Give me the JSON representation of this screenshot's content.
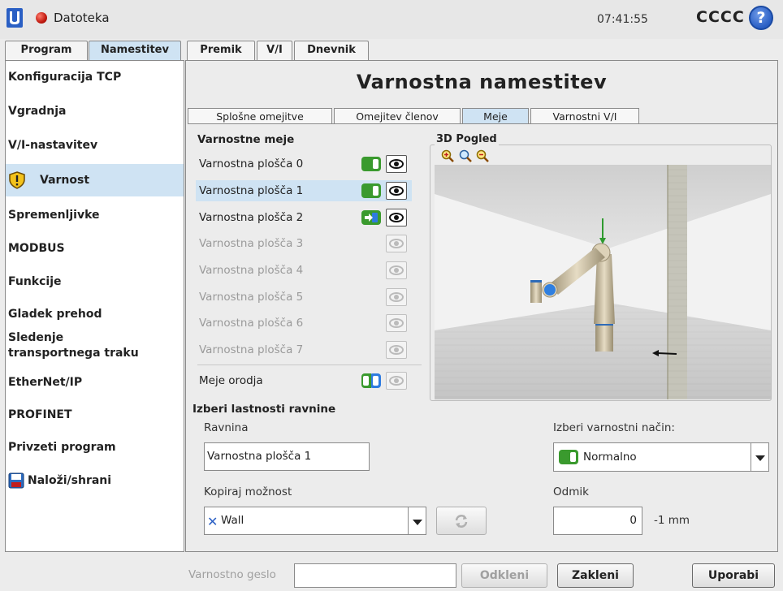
{
  "topbar": {
    "file_label": "Datoteka",
    "clock": "07:41:55",
    "robot_name": "CCCC",
    "help_symbol": "?",
    "icons": [
      "ur-logo-icon",
      "record-dot-icon",
      "help-icon"
    ]
  },
  "main_tabs": [
    "Program",
    "Namestitev",
    "Premik",
    "V/I",
    "Dnevnik"
  ],
  "main_tab_active": "Namestitev",
  "sidebar": {
    "items": [
      {
        "label": "Konfiguracija TCP"
      },
      {
        "label": "Vgradnja"
      },
      {
        "label": "V/I-nastavitev"
      },
      {
        "label": "Varnost",
        "icon": "shield-warning-icon"
      },
      {
        "label": "Spremenljivke"
      },
      {
        "label": "MODBUS"
      },
      {
        "label": "Funkcije"
      },
      {
        "label": "Gladek prehod"
      },
      {
        "label": "Sledenje\ntransportnega traku"
      },
      {
        "label": "EtherNet/IP"
      },
      {
        "label": "PROFINET"
      },
      {
        "label": "Privzeti program"
      },
      {
        "label": "Naloži/shrani",
        "icon": "floppy-disk-icon"
      }
    ],
    "active": "Varnost"
  },
  "content": {
    "title": "Varnostna namestitev",
    "sub_tabs": [
      "Splošne omejitve",
      "Omejitev členov",
      "Meje",
      "Varnostni V/I"
    ],
    "sub_tab_active": "Meje",
    "boundaries": {
      "heading": "Varnostne meje",
      "planes": [
        {
          "label": "Varnostna plošča 0",
          "mode": "normal",
          "enabled": true
        },
        {
          "label": "Varnostna plošča 1",
          "mode": "normal",
          "enabled": true,
          "selected": true
        },
        {
          "label": "Varnostna plošča 2",
          "mode": "trigger",
          "enabled": true
        },
        {
          "label": "Varnostna plošča 3",
          "enabled": false
        },
        {
          "label": "Varnostna plošča 4",
          "enabled": false
        },
        {
          "label": "Varnostna plošča 5",
          "enabled": false
        },
        {
          "label": "Varnostna plošča 6",
          "enabled": false
        },
        {
          "label": "Varnostna plošča 7",
          "enabled": false
        }
      ],
      "tool_boundary": {
        "label": "Meje orodja",
        "mode": "blue"
      }
    },
    "view3d": {
      "title": "3D Pogled",
      "zoom_icons": [
        "zoom-in-icon",
        "zoom-fit-icon",
        "zoom-out-icon"
      ]
    },
    "plane_properties": {
      "heading": "Izberi lastnosti ravnine",
      "plane_label": "Ravnina",
      "plane_value": "Varnostna plošča 1",
      "copy_label": "Kopiraj možnost",
      "copy_value": "Wall",
      "copy_icon": "wall-x-icon",
      "refresh_icon": "refresh-icon",
      "mode_label": "Izberi varnostni način:",
      "mode_value": "Normalno",
      "offset_label": "Odmik",
      "offset_value": "0",
      "offset_unit": "-1 mm"
    }
  },
  "footer": {
    "password_placeholder": "Varnostno geslo",
    "unlock_label": "Odkleni",
    "lock_label": "Zakleni",
    "apply_label": "Uporabi"
  },
  "colors": {
    "accent_selected": "#cfe3f3",
    "toggle_green": "#3a9a2e",
    "toggle_blue": "#2e7be0",
    "record_red": "#c01a10",
    "help_blue": "#2a5fc4"
  }
}
